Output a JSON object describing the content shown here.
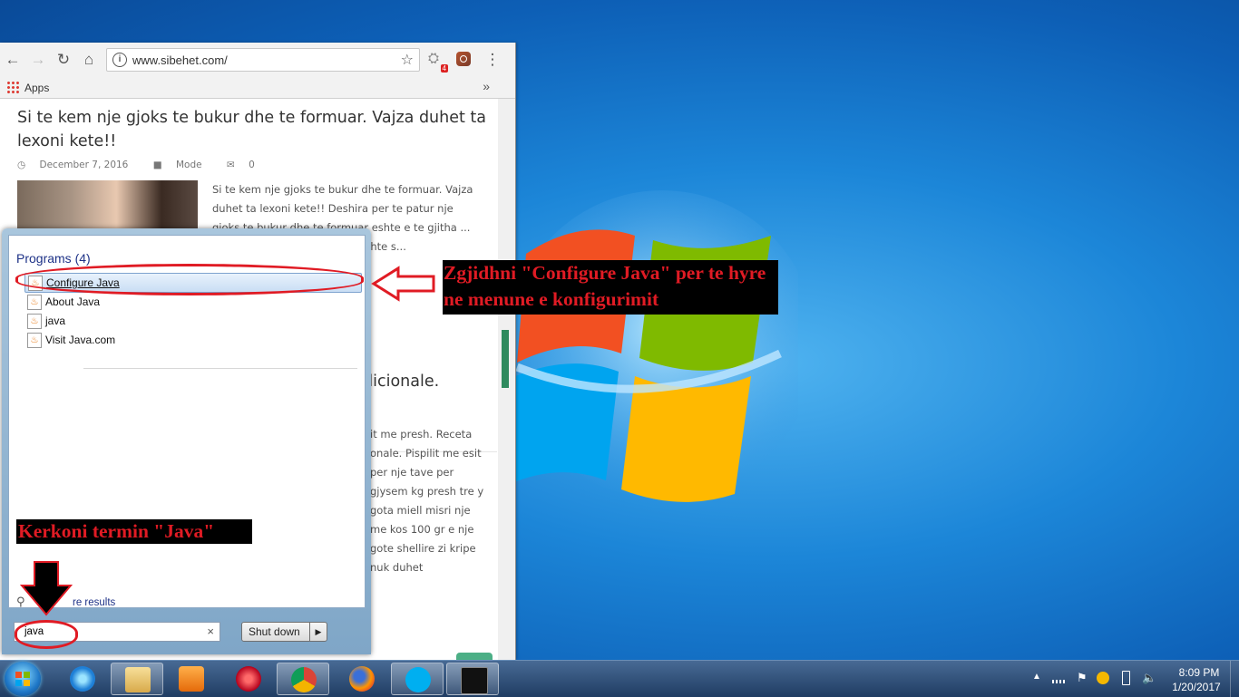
{
  "browser": {
    "url": "www.sibehet.com/",
    "extension_badge": "4",
    "bookmarks": {
      "apps_label": "Apps",
      "more": "»"
    }
  },
  "page": {
    "article_title": "Si te kem nje gjoks te bukur dhe te formuar. Vajza duhet ta lexoni kete!!",
    "date": "December 7, 2016",
    "category": "Mode",
    "comments": "0",
    "excerpt": "Si te kem nje gjoks te bukur dhe te formuar. Vajza duhet ta lexoni kete!! Deshira per te patur nje gjoks te bukur dhe te formuar eshte e te gjitha ... per tu dukur bukur ... rseve eshte s...",
    "article2_title_fragment": "dicionale.",
    "excerpt2": "it me presh. Receta onale. Pispilit me esit per nje tave per gjysem kg presh tre y gota miell misri nje me kos 100 gr e nje gote shellire zi kripe nuk duhet"
  },
  "start_menu": {
    "heading": "Programs (4)",
    "items": [
      {
        "label": "Configure Java"
      },
      {
        "label": "About Java"
      },
      {
        "label": "java"
      },
      {
        "label": "Visit Java.com"
      }
    ],
    "see_more": "re results",
    "search_value": "java",
    "shutdown_label": "Shut down"
  },
  "annotations": {
    "select_hint": "Zgjidhni \"Configure Java\" per te hyre ne menune e konfigurimit",
    "search_hint": "Kerkoni termin \"Java\""
  },
  "taskbar": {
    "apps": [
      "internet-explorer",
      "file-explorer",
      "media-player",
      "app-red",
      "chrome",
      "firefox",
      "skype",
      "command-prompt"
    ],
    "clock_time": "8:09 PM",
    "clock_date": "1/20/2017"
  },
  "colors": {
    "annotation_red": "#e01b24",
    "accent_green": "#4caf86",
    "start_heading": "#1e3287"
  }
}
